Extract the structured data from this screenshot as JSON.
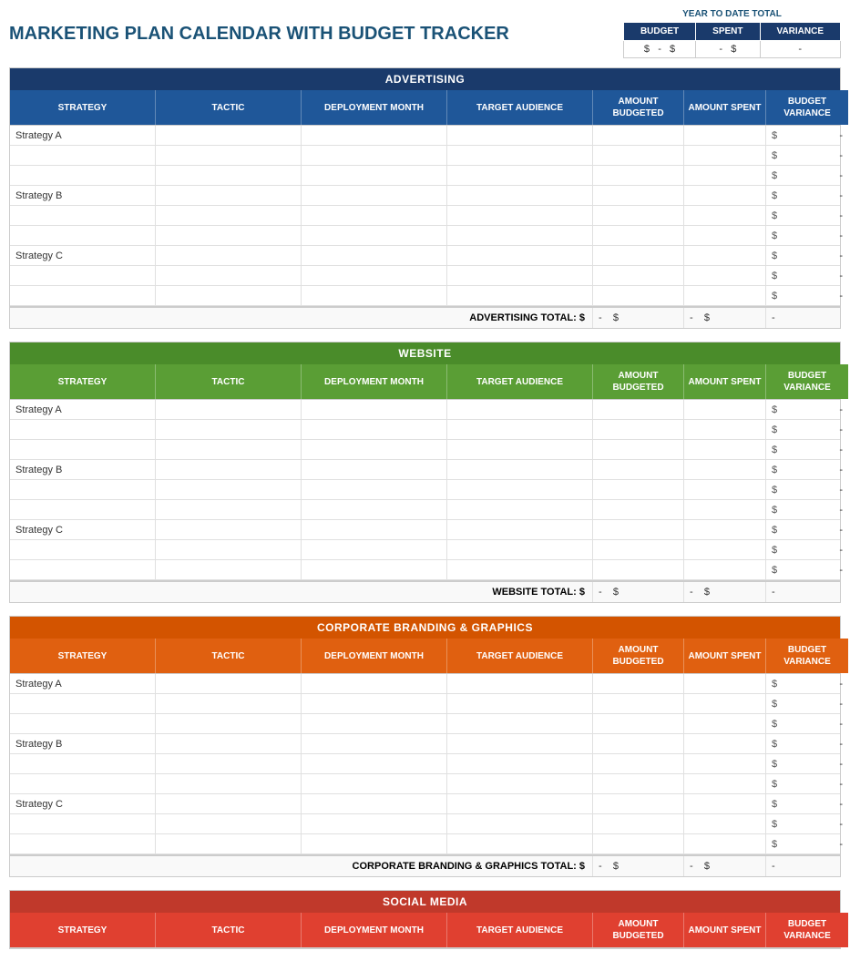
{
  "title": "MARKETING PLAN CALENDAR WITH BUDGET TRACKER",
  "ytd": {
    "label": "YEAR TO DATE TOTAL",
    "columns": [
      "BUDGET",
      "SPENT",
      "VARIANCE"
    ],
    "values": [
      "$ -",
      "$ -",
      "$ -"
    ]
  },
  "columns": [
    "STRATEGY",
    "TACTIC",
    "DEPLOYMENT MONTH",
    "TARGET AUDIENCE",
    "AMOUNT BUDGETED",
    "AMOUNT SPENT",
    "BUDGET VARIANCE"
  ],
  "sections": [
    {
      "id": "advertising",
      "title": "ADVERTISING",
      "color_class": "advertising",
      "strategies": [
        "Strategy A",
        "Strategy B",
        "Strategy C"
      ],
      "rows_per_strategy": 3,
      "total_label": "ADVERTISING TOTAL:",
      "total_values": [
        "$ -",
        "$ -",
        "$ -"
      ]
    },
    {
      "id": "website",
      "title": "WEBSITE",
      "color_class": "website",
      "strategies": [
        "Strategy A",
        "Strategy B",
        "Strategy C"
      ],
      "rows_per_strategy": 3,
      "total_label": "WEBSITE TOTAL:",
      "total_values": [
        "$ -",
        "$ -",
        "$ -"
      ]
    },
    {
      "id": "corporate",
      "title": "CORPORATE BRANDING & GRAPHICS",
      "color_class": "corporate",
      "strategies": [
        "Strategy A",
        "Strategy B",
        "Strategy C"
      ],
      "rows_per_strategy": 3,
      "total_label": "CORPORATE BRANDING & GRAPHICS TOTAL:",
      "total_values": [
        "$ -",
        "$ -",
        "$ -"
      ]
    },
    {
      "id": "social",
      "title": "SOCIAL MEDIA",
      "color_class": "social",
      "strategies": [],
      "rows_per_strategy": 0,
      "total_label": "",
      "total_values": [
        "$ -",
        "$ -",
        "$ -"
      ]
    }
  ],
  "col_labels": {
    "strategy": "STRATEGY",
    "tactic": "TACTIC",
    "deployment": "DEPLOYMENT MONTH",
    "audience": "TARGET AUDIENCE",
    "budgeted": "AMOUNT BUDGETED",
    "spent": "AMOUNT SPENT",
    "variance": "BUDGET VARIANCE"
  }
}
